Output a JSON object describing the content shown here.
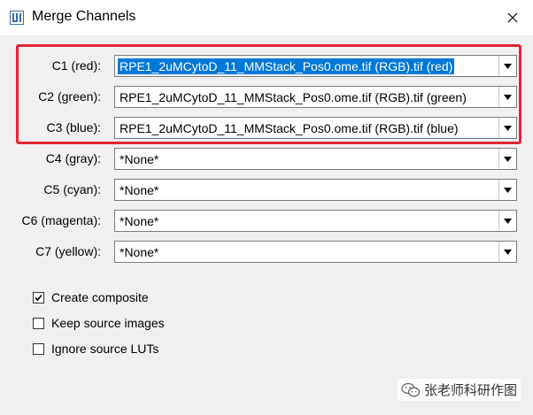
{
  "window": {
    "title": "Merge Channels"
  },
  "channels": [
    {
      "label": "C1 (red):",
      "value": "RPE1_2uMCytoD_11_MMStack_Pos0.ome.tif (RGB).tif (red)"
    },
    {
      "label": "C2 (green):",
      "value": "RPE1_2uMCytoD_11_MMStack_Pos0.ome.tif (RGB).tif (green)"
    },
    {
      "label": "C3 (blue):",
      "value": "RPE1_2uMCytoD_11_MMStack_Pos0.ome.tif (RGB).tif (blue)"
    },
    {
      "label": "C4 (gray):",
      "value": "*None*"
    },
    {
      "label": "C5 (cyan):",
      "value": "*None*"
    },
    {
      "label": "C6 (magenta):",
      "value": "*None*"
    },
    {
      "label": "C7 (yellow):",
      "value": "*None*"
    }
  ],
  "options": [
    {
      "label": "Create composite",
      "checked": true
    },
    {
      "label": "Keep source images",
      "checked": false
    },
    {
      "label": "Ignore source LUTs",
      "checked": false
    }
  ],
  "watermark": {
    "text": "张老师科研作图",
    "icon": "wechat-icon"
  },
  "colors": {
    "highlight": "#e32636",
    "selection": "#0078d7"
  }
}
